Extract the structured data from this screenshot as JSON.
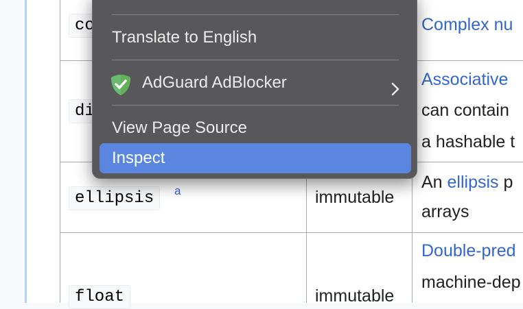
{
  "table": {
    "rows": [
      {
        "name": "co",
        "mutability": "",
        "description": "Complex nu"
      },
      {
        "name": "di",
        "mutability": "",
        "description_link": "Associative",
        "description_line2": "can contain",
        "description_line3": "a hashable t"
      },
      {
        "name": "ellipsis",
        "superscript": "a",
        "mutability": "immutable",
        "description_prefix": "An ",
        "description_link": "ellipsis",
        "description_suffix": " p",
        "description_line2": "arrays"
      },
      {
        "name": "float",
        "mutability": "immutable",
        "description_link": "Double-pred",
        "description_line2": "machine-dep"
      }
    ]
  },
  "context_menu": {
    "items": [
      {
        "label": "Translate to English"
      },
      {
        "label": "AdGuard AdBlocker",
        "icon": "adguard-shield-icon",
        "submenu": true
      },
      {
        "label": "View Page Source"
      },
      {
        "label": "Inspect",
        "highlighted": true
      }
    ]
  },
  "colors": {
    "menu_bg": "#58585a",
    "menu_highlight": "#5b86e0",
    "link": "#3366cc",
    "adguard_green": "#68bc71"
  }
}
